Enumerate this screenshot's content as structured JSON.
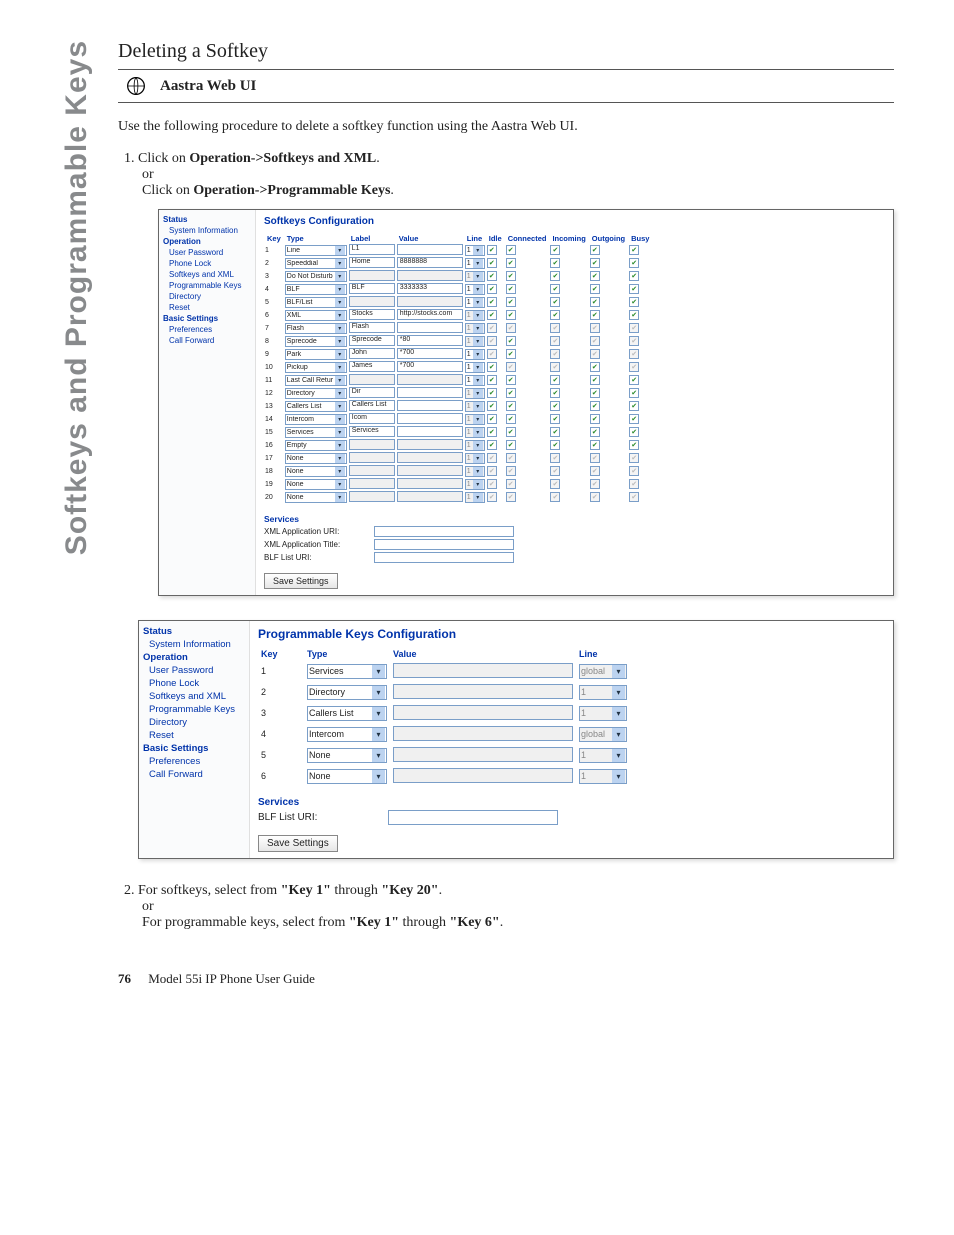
{
  "sideTab": "Softkeys and Programmable Keys",
  "heading": "Deleting a Softkey",
  "subheading": "Aastra Web UI",
  "intro": "Use the following procedure to delete a softkey function using the Aastra Web UI.",
  "step1_a_prefix": "Click on ",
  "step1_a_bold": "Operation->Softkeys and XML",
  "or": "or",
  "step1_b_prefix": "Click on ",
  "step1_b_bold": "Operation->Programmable Keys",
  "nav": {
    "status": "Status",
    "sysinfo": "System Information",
    "operation": "Operation",
    "userpw": "User Password",
    "phonelock": "Phone Lock",
    "skxml": "Softkeys and XML",
    "progkeys": "Programmable Keys",
    "directory": "Directory",
    "reset": "Reset",
    "basic": "Basic Settings",
    "prefs": "Preferences",
    "cfwd": "Call Forward"
  },
  "softkeysPanel": {
    "title": "Softkeys Configuration",
    "headers": [
      "Key",
      "Type",
      "Label",
      "Value",
      "Line",
      "Idle",
      "Connected",
      "Incoming",
      "Outgoing",
      "Busy"
    ],
    "rows": [
      {
        "key": "1",
        "type": "Line",
        "label": "L1",
        "value": "",
        "line": "1",
        "lineEnabled": true,
        "states": [
          true,
          true,
          true,
          true,
          true
        ]
      },
      {
        "key": "2",
        "type": "Speeddial",
        "label": "Home",
        "value": "8888888",
        "line": "1",
        "lineEnabled": true,
        "states": [
          true,
          true,
          true,
          true,
          true
        ]
      },
      {
        "key": "3",
        "type": "Do Not Disturb",
        "label": "",
        "value": "",
        "line": "1",
        "lineEnabled": false,
        "states": [
          true,
          true,
          true,
          true,
          true
        ]
      },
      {
        "key": "4",
        "type": "BLF",
        "label": "BLF",
        "value": "3333333",
        "line": "1",
        "lineEnabled": true,
        "states": [
          true,
          true,
          true,
          true,
          true
        ]
      },
      {
        "key": "5",
        "type": "BLF/List",
        "label": "",
        "value": "",
        "line": "1",
        "lineEnabled": true,
        "states": [
          true,
          true,
          true,
          true,
          true
        ]
      },
      {
        "key": "6",
        "type": "XML",
        "label": "Stocks",
        "value": "http://stocks.com",
        "line": "1",
        "lineEnabled": false,
        "states": [
          true,
          true,
          true,
          true,
          true
        ]
      },
      {
        "key": "7",
        "type": "Flash",
        "label": "Flash",
        "value": "",
        "line": "1",
        "lineEnabled": false,
        "states": [
          false,
          false,
          false,
          false,
          false
        ],
        "grey": true
      },
      {
        "key": "8",
        "type": "Sprecode",
        "label": "Sprecode",
        "value": "*80",
        "line": "1",
        "lineEnabled": false,
        "states": [
          false,
          true,
          false,
          false,
          false
        ],
        "grey": true
      },
      {
        "key": "9",
        "type": "Park",
        "label": "John",
        "value": "*700",
        "line": "1",
        "lineEnabled": true,
        "states": [
          false,
          true,
          false,
          false,
          false
        ],
        "grey": true
      },
      {
        "key": "10",
        "type": "Pickup",
        "label": "James",
        "value": "*700",
        "line": "1",
        "lineEnabled": true,
        "states": [
          true,
          false,
          false,
          true,
          false
        ],
        "grey": true
      },
      {
        "key": "11",
        "type": "Last Call Return",
        "label": "",
        "value": "",
        "line": "1",
        "lineEnabled": true,
        "states": [
          true,
          true,
          true,
          true,
          true
        ]
      },
      {
        "key": "12",
        "type": "Directory",
        "label": "Dir",
        "value": "",
        "line": "1",
        "lineEnabled": false,
        "states": [
          true,
          true,
          true,
          true,
          true
        ]
      },
      {
        "key": "13",
        "type": "Callers List",
        "label": "Callers List",
        "value": "",
        "line": "1",
        "lineEnabled": false,
        "states": [
          true,
          true,
          true,
          true,
          true
        ]
      },
      {
        "key": "14",
        "type": "Intercom",
        "label": "Icom",
        "value": "",
        "line": "1",
        "lineEnabled": false,
        "states": [
          true,
          true,
          true,
          true,
          true
        ]
      },
      {
        "key": "15",
        "type": "Services",
        "label": "Services",
        "value": "",
        "line": "1",
        "lineEnabled": false,
        "states": [
          true,
          true,
          true,
          true,
          true
        ]
      },
      {
        "key": "16",
        "type": "Empty",
        "label": "",
        "value": "",
        "line": "1",
        "lineEnabled": false,
        "states": [
          true,
          true,
          true,
          true,
          true
        ]
      },
      {
        "key": "17",
        "type": "None",
        "label": "",
        "value": "",
        "line": "1",
        "lineEnabled": false,
        "states": [
          false,
          false,
          false,
          false,
          false
        ],
        "grey": true
      },
      {
        "key": "18",
        "type": "None",
        "label": "",
        "value": "",
        "line": "1",
        "lineEnabled": false,
        "states": [
          false,
          false,
          false,
          false,
          false
        ],
        "grey": true
      },
      {
        "key": "19",
        "type": "None",
        "label": "",
        "value": "",
        "line": "1",
        "lineEnabled": false,
        "states": [
          false,
          false,
          false,
          false,
          false
        ],
        "grey": true
      },
      {
        "key": "20",
        "type": "None",
        "label": "",
        "value": "",
        "line": "1",
        "lineEnabled": false,
        "states": [
          false,
          false,
          false,
          false,
          false
        ],
        "grey": true
      }
    ],
    "servicesHead": "Services",
    "xmlUri": "XML Application URI:",
    "xmlTitle": "XML Application Title:",
    "blfUri": "BLF List URI:",
    "saveBtn": "Save Settings"
  },
  "progPanel": {
    "title": "Programmable Keys Configuration",
    "headers": [
      "Key",
      "Type",
      "Value",
      "Line"
    ],
    "rows": [
      {
        "key": "1",
        "type": "Services",
        "value": "",
        "line": "global",
        "lineEnabled": false
      },
      {
        "key": "2",
        "type": "Directory",
        "value": "",
        "line": "1",
        "lineEnabled": false
      },
      {
        "key": "3",
        "type": "Callers List",
        "value": "",
        "line": "1",
        "lineEnabled": false
      },
      {
        "key": "4",
        "type": "Intercom",
        "value": "",
        "line": "global",
        "lineEnabled": false
      },
      {
        "key": "5",
        "type": "None",
        "value": "",
        "line": "1",
        "lineEnabled": false
      },
      {
        "key": "6",
        "type": "None",
        "value": "",
        "line": "1",
        "lineEnabled": false
      }
    ],
    "servicesHead": "Services",
    "blfUri": "BLF List URI:",
    "saveBtn": "Save Settings"
  },
  "step2_a": "For softkeys, select from ",
  "step2_a_b1": "\"Key 1\"",
  "step2_a_mid": " through ",
  "step2_a_b2": "\"Key 20\"",
  "step2_b": "For programmable keys, select from ",
  "step2_b_b1": "\"Key 1\"",
  "step2_b_mid": " through ",
  "step2_b_b2": "\"Key 6\"",
  "footer": {
    "page": "76",
    "title": "Model 55i IP Phone User Guide"
  }
}
